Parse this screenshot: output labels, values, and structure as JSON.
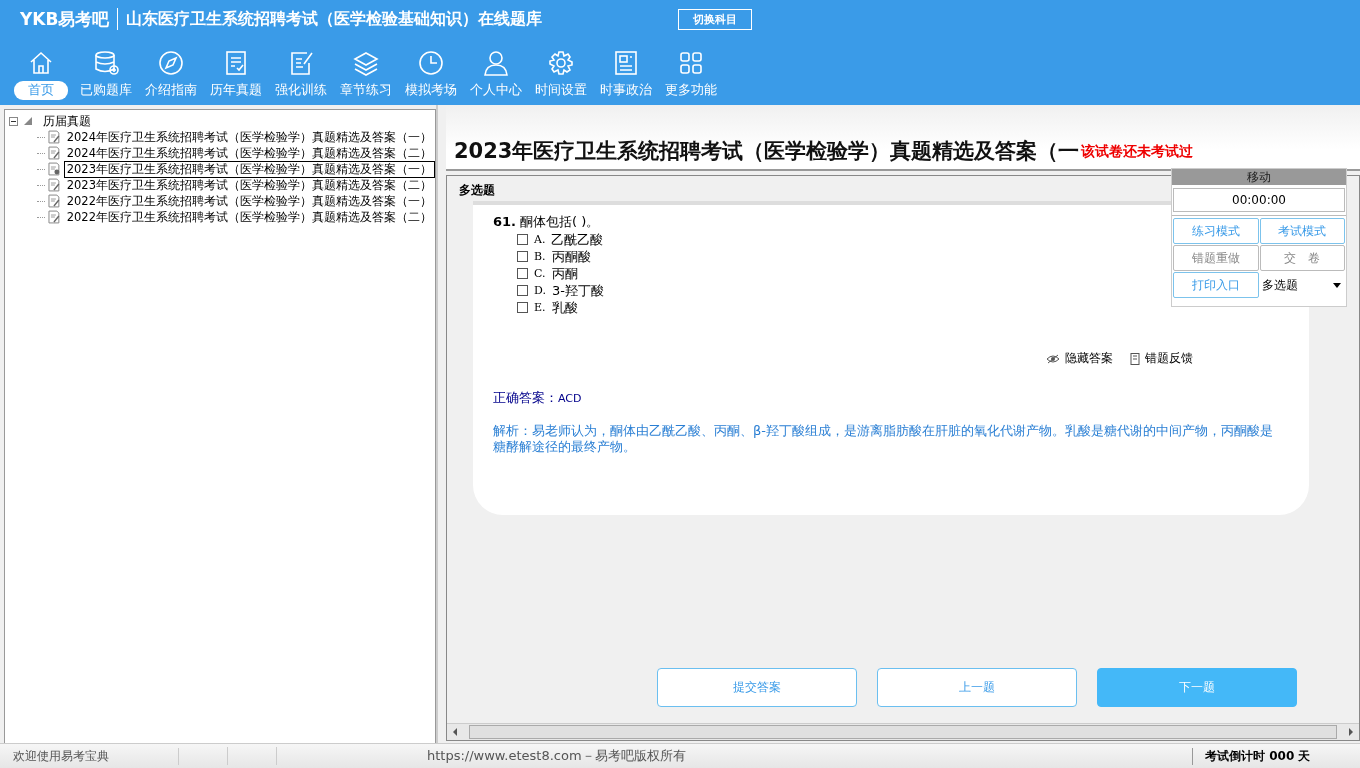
{
  "header": {
    "logo": "YKB易考吧",
    "title": "山东医疗卫生系统招聘考试（医学检验基础知识）在线题库",
    "switch_button": "切换科目"
  },
  "nav": [
    {
      "label": "首页",
      "selected": true
    },
    {
      "label": "已购题库",
      "selected": false
    },
    {
      "label": "介绍指南",
      "selected": false
    },
    {
      "label": "历年真题",
      "selected": false
    },
    {
      "label": "强化训练",
      "selected": false
    },
    {
      "label": "章节练习",
      "selected": false
    },
    {
      "label": "模拟考场",
      "selected": false
    },
    {
      "label": "个人中心",
      "selected": false
    },
    {
      "label": "时间设置",
      "selected": false
    },
    {
      "label": "时事政治",
      "selected": false
    },
    {
      "label": "更多功能",
      "selected": false
    }
  ],
  "tree": {
    "label": "历届真题",
    "expanded": true,
    "children": [
      {
        "label": "2024年医疗卫生系统招聘考试（医学检验学）真题精选及答案（一）",
        "selected": false
      },
      {
        "label": "2024年医疗卫生系统招聘考试（医学检验学）真题精选及答案（二）",
        "selected": false
      },
      {
        "label": "2023年医疗卫生系统招聘考试（医学检验学）真题精选及答案（一）",
        "selected": true
      },
      {
        "label": "2023年医疗卫生系统招聘考试（医学检验学）真题精选及答案（二）",
        "selected": false
      },
      {
        "label": "2022年医疗卫生系统招聘考试（医学检验学）真题精选及答案（一）",
        "selected": false
      },
      {
        "label": "2022年医疗卫生系统招聘考试（医学检验学）真题精选及答案（二）",
        "selected": false
      }
    ]
  },
  "exam": {
    "title": "2023年医疗卫生系统招聘考试（医学检验学）真题精选及答案（一",
    "status": "该试卷还未考试过",
    "section": "多选题",
    "question": {
      "number": "61.",
      "text": "酮体包括(  )。",
      "options": [
        {
          "letter": "A.",
          "text": "乙酰乙酸",
          "checked": false
        },
        {
          "letter": "B.",
          "text": "丙酮酸",
          "checked": false
        },
        {
          "letter": "C.",
          "text": "丙酮",
          "checked": false
        },
        {
          "letter": "D.",
          "text": "3-羟丁酸",
          "checked": false
        },
        {
          "letter": "E.",
          "text": "乳酸",
          "checked": false
        }
      ]
    },
    "hide_answer": "隐藏答案",
    "report_error": "错题反馈",
    "answer_label": "正确答案：",
    "answer": "ACD",
    "analysis": "解析：易老师认为，酮体由乙酰乙酸、丙酮、β-羟丁酸组成，是游离脂肪酸在肝脏的氧化代谢产物。乳酸是糖代谢的中间产物，丙酮酸是糖酵解途径的最终产物。",
    "buttons": [
      {
        "label": "提交答案",
        "kind": "outline"
      },
      {
        "label": "上一题",
        "kind": "outline"
      },
      {
        "label": "下一题",
        "kind": "primary"
      }
    ]
  },
  "widget": {
    "title": "移动",
    "timer": "00:00:00",
    "buttons": [
      {
        "label": "练习模式",
        "disabled": false
      },
      {
        "label": "考试模式",
        "disabled": false
      },
      {
        "label": "错题重做",
        "disabled": true
      },
      {
        "label": "交　卷",
        "disabled": true
      },
      {
        "label": "打印入口",
        "disabled": false
      }
    ],
    "dropdown": "多选题"
  },
  "status_bar": {
    "welcome": "欢迎使用易考宝典",
    "copyright": "https://www.etest8.com－易考吧版权所有",
    "countdown": "考试倒计时 000 天"
  }
}
